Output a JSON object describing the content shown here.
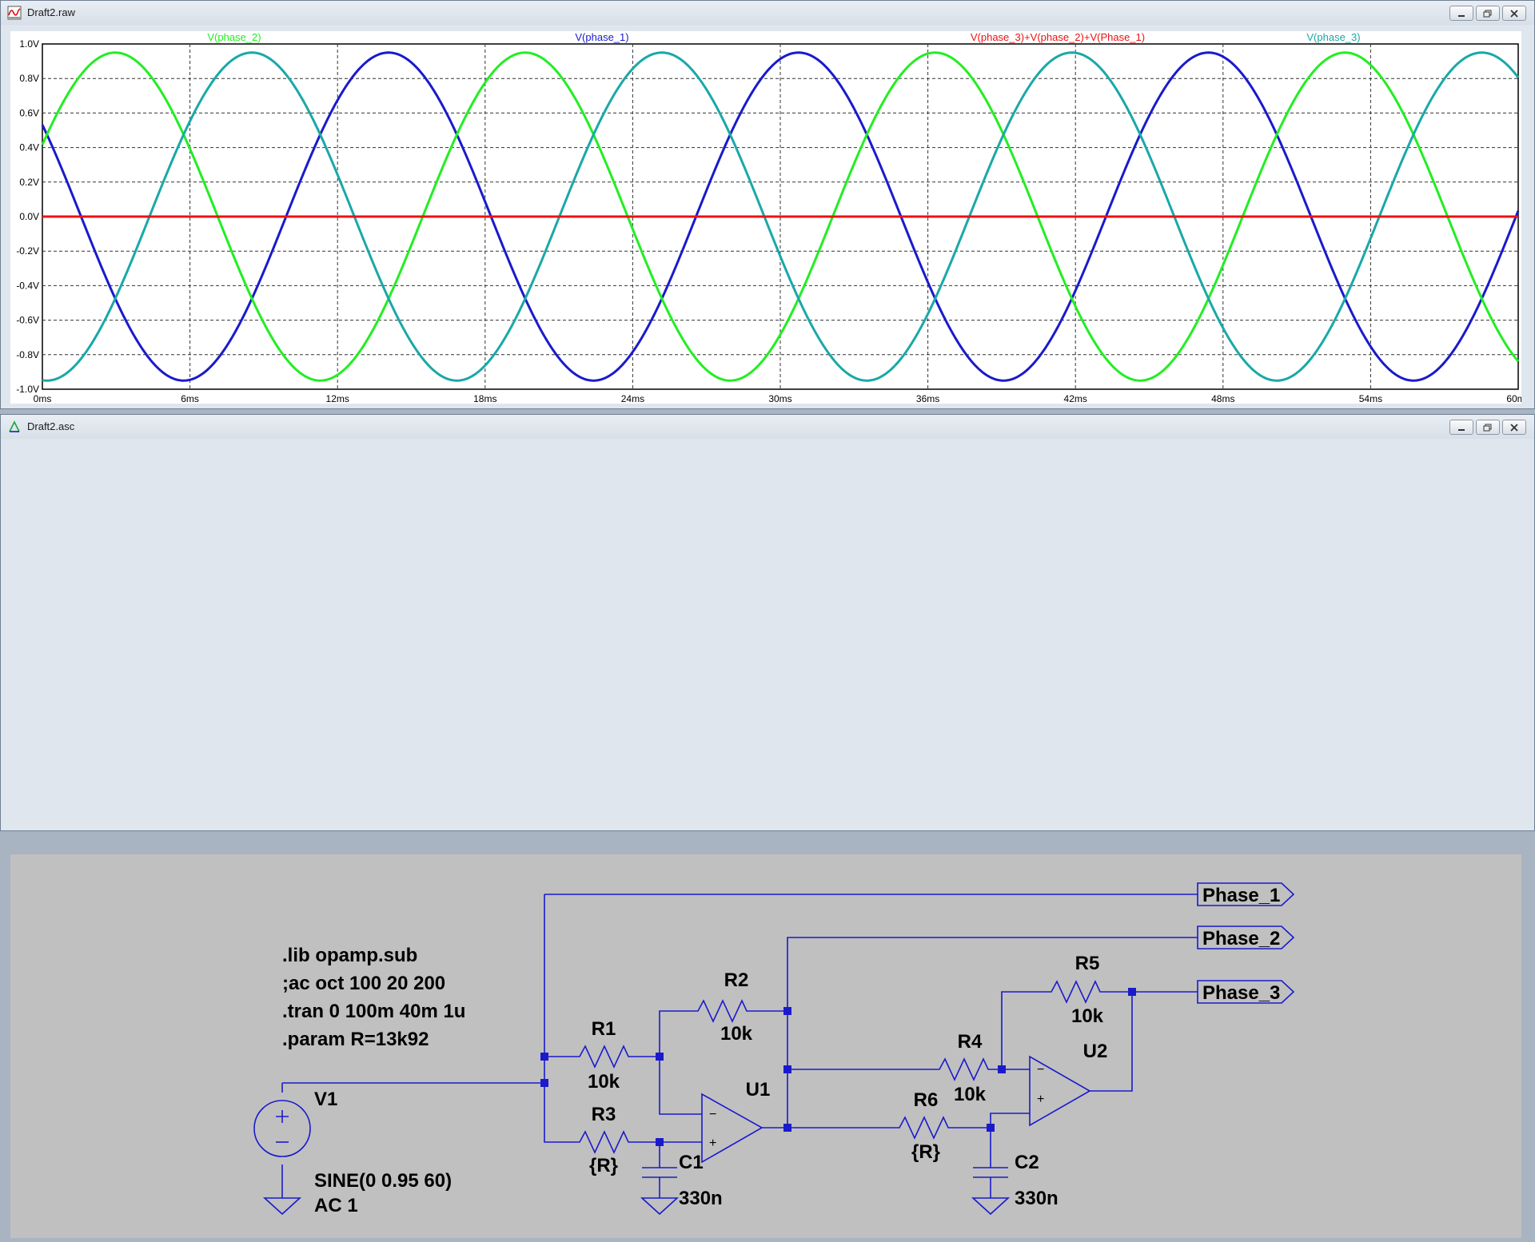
{
  "plot_window": {
    "title": "Draft2.raw",
    "icon": "waveform-icon"
  },
  "schematic_window": {
    "title": "Draft2.asc",
    "icon": "schematic-icon"
  },
  "window_controls": {
    "minimize": "minimize-icon",
    "restore": "restore-icon",
    "close": "close-icon"
  },
  "chart_data": {
    "type": "line",
    "title": "",
    "xlabel": "",
    "ylabel": "",
    "xlim": [
      0,
      60
    ],
    "ylim": [
      -1.0,
      1.0
    ],
    "x_unit": "ms",
    "y_unit": "V",
    "x_ticks": [
      "0ms",
      "6ms",
      "12ms",
      "18ms",
      "24ms",
      "30ms",
      "36ms",
      "42ms",
      "48ms",
      "54ms",
      "60ms"
    ],
    "y_ticks": [
      "1.0V",
      "0.8V",
      "0.6V",
      "0.4V",
      "0.2V",
      "0.0V",
      "-0.2V",
      "-0.4V",
      "-0.6V",
      "-0.8V",
      "-1.0V"
    ],
    "grid": true,
    "legend_position": "top",
    "series": [
      {
        "name": "V(phase_2)",
        "color": "#22ee22",
        "amplitude": 0.95,
        "freq_hz": 60,
        "phase_deg": 26
      },
      {
        "name": "V(phase_1)",
        "color": "#1a1acc",
        "amplitude": 0.95,
        "freq_hz": 60,
        "phase_deg": 146
      },
      {
        "name": "V(phase_3)+V(phase_2)+V(Phase_1)",
        "color": "#ee1111",
        "amplitude": 0.0,
        "freq_hz": 60,
        "phase_deg": 0
      },
      {
        "name": "V(phase_3)",
        "color": "#1aa8a8",
        "amplitude": 0.95,
        "freq_hz": 60,
        "phase_deg": 266
      }
    ]
  },
  "schematic": {
    "directives": [
      ".lib opamp.sub",
      ";ac oct 100 20 200",
      ".tran 0 100m 40m 1u",
      ".param R=13k92"
    ],
    "components": {
      "R1": {
        "name": "R1",
        "value": "10k"
      },
      "R2": {
        "name": "R2",
        "value": "10k"
      },
      "R3": {
        "name": "R3",
        "value": "{R}"
      },
      "R4": {
        "name": "R4",
        "value": "10k"
      },
      "R5": {
        "name": "R5",
        "value": "10k"
      },
      "R6": {
        "name": "R6",
        "value": "{R}"
      },
      "C1": {
        "name": "C1",
        "value": "330n"
      },
      "C2": {
        "name": "C2",
        "value": "330n"
      },
      "U1": {
        "name": "U1"
      },
      "U2": {
        "name": "U2"
      },
      "V1": {
        "name": "V1",
        "value": "SINE(0 0.95 60)",
        "value2": "AC 1"
      }
    },
    "labels": {
      "phase1": "Phase_1",
      "phase2": "Phase_2",
      "phase3": "Phase_3"
    },
    "opamp_signs": {
      "minus": "−",
      "plus": "+"
    }
  }
}
